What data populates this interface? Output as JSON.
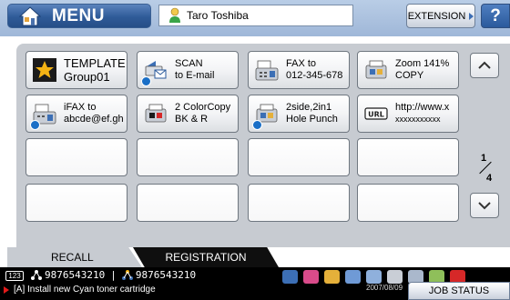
{
  "header": {
    "menu_label": "MENU",
    "user_name": "Taro Toshiba",
    "extension_label": "EXTENSION",
    "help_label": "?"
  },
  "templates": [
    {
      "line1": "TEMPLATE",
      "line2": "Group01",
      "icon": "star-icon"
    },
    {
      "line1": "SCAN",
      "line2": "to E-mail",
      "icon": "scan-email-icon"
    },
    {
      "line1": "FAX to",
      "line2": "012-345-678",
      "icon": "fax-icon"
    },
    {
      "line1": "Zoom 141%",
      "line2": "COPY",
      "icon": "copy-icon"
    },
    {
      "line1": "iFAX to",
      "line2": "abcde@ef.gh",
      "icon": "ifax-icon"
    },
    {
      "line1": "2 ColorCopy",
      "line2": "BK & R",
      "icon": "color-copy-icon"
    },
    {
      "line1": "2side,2in1",
      "line2": "Hole Punch",
      "icon": "duplex-copy-icon"
    },
    {
      "line1": "http://www.x",
      "line2": "xxxxxxxxxxx",
      "icon": "url-icon"
    }
  ],
  "pagination": {
    "current": "1",
    "total": "4"
  },
  "tabs": {
    "recall": "RECALL",
    "registration": "REGISTRATION"
  },
  "status": {
    "fax_indicator": "123",
    "line_a": "9876543210",
    "line_b": "9876543210",
    "alert_text": "[A] Install new Cyan toner cartridge",
    "date": "2007/08/09",
    "job_status": "JOB STATUS"
  },
  "colors": {
    "header_blue": "#2f5b98",
    "panel_gray": "#c7cbd1",
    "alert_red": "#e21a1a",
    "badge_blue": "#1a6fc7"
  }
}
